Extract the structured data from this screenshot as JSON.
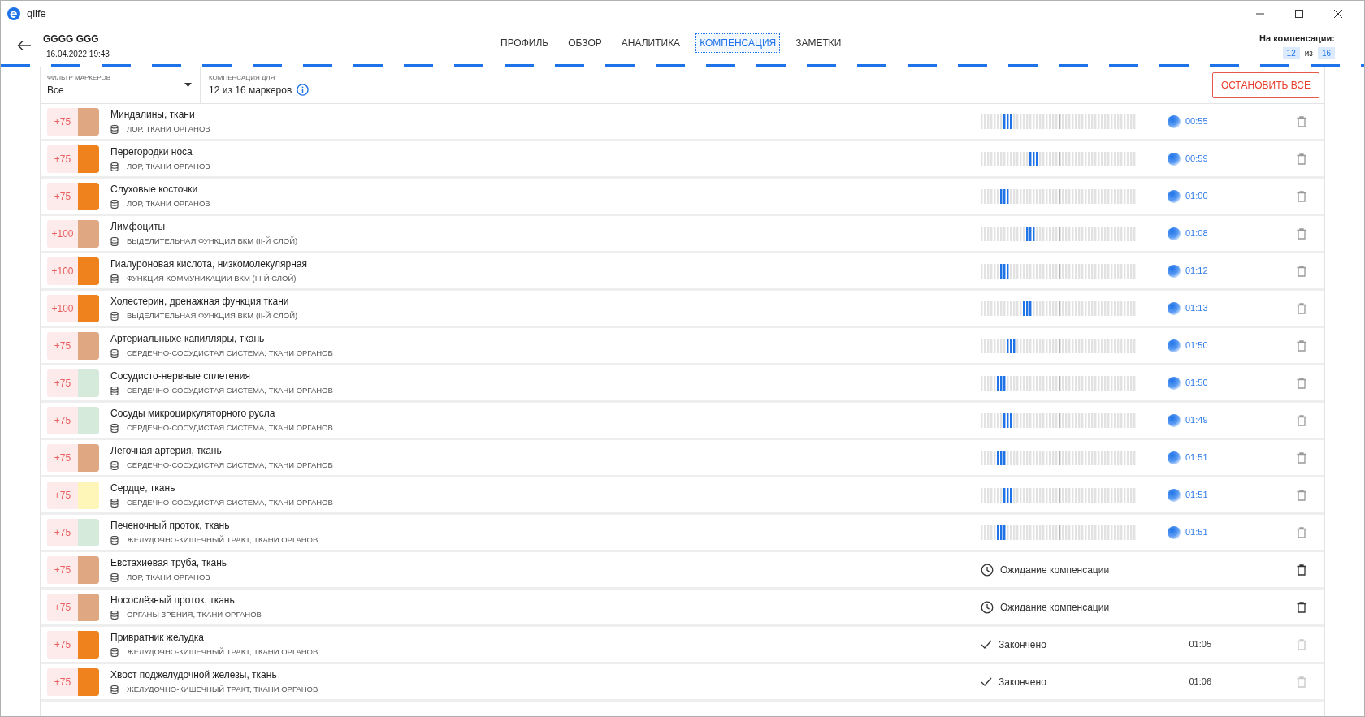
{
  "window": {
    "title": "qlife"
  },
  "header": {
    "patient": "GGGG GGG",
    "date": "16.04.2022 19:43"
  },
  "tabs": [
    {
      "label": "ПРОФИЛЬ",
      "selected": false
    },
    {
      "label": "ОБЗОР",
      "selected": false
    },
    {
      "label": "АНАЛИТИКА",
      "selected": false
    },
    {
      "label": "КОМПЕНСАЦИЯ",
      "selected": true
    },
    {
      "label": "ЗАМЕТКИ",
      "selected": false
    }
  ],
  "summary": {
    "label": "На компенсации:",
    "current": "12",
    "separator": "из",
    "total": "16"
  },
  "filter": {
    "label": "ФИЛЬТР МАРКЕРОВ",
    "value": "Все"
  },
  "compensation_for": {
    "label": "КОМПЕНСАЦИЯ ДЛЯ",
    "value": "12 из 16 маркеров"
  },
  "stop_all_button": "ОСТАНОВИТЬ ВСЕ",
  "rows": [
    {
      "kind": "active",
      "score": "+75",
      "color": "#dfa882",
      "name": "Миндалины, ткани",
      "category": "ЛОР, ТКАНИ ОРГАНОВ",
      "level": 0.16,
      "time": "00:55"
    },
    {
      "kind": "active",
      "score": "+75",
      "color": "#f0821e",
      "name": "Перегородки носа",
      "category": "ЛОР, ТКАНИ ОРГАНОВ",
      "level": 0.34,
      "time": "00:59"
    },
    {
      "kind": "active",
      "score": "+75",
      "color": "#f0821e",
      "name": "Слуховые косточки",
      "category": "ЛОР, ТКАНИ ОРГАНОВ",
      "level": 0.14,
      "time": "01:00"
    },
    {
      "kind": "active",
      "score": "+100",
      "color": "#dfa882",
      "name": "Лимфоциты",
      "category": "ВЫДЕЛИТЕЛЬНАЯ ФУНКЦИЯ ВКМ (II-Й СЛОЙ)",
      "level": 0.32,
      "time": "01:08"
    },
    {
      "kind": "active",
      "score": "+100",
      "color": "#f0821e",
      "name": "Гиалуроновая кислота, низкомолекулярная",
      "category": "ФУНКЦИЯ КОММУНИКАЦИИ ВКМ (III-Й СЛОЙ)",
      "level": 0.14,
      "time": "01:12"
    },
    {
      "kind": "active",
      "score": "+100",
      "color": "#f0821e",
      "name": "Холестерин, дренажная функция ткани",
      "category": "ВЫДЕЛИТЕЛЬНАЯ ФУНКЦИЯ ВКМ (II-Й СЛОЙ)",
      "level": 0.29,
      "time": "01:13"
    },
    {
      "kind": "active",
      "score": "+75",
      "color": "#dfa882",
      "name": "Артериальныхе капилляры, ткань",
      "category": "СЕРДЕЧНО-СОСУДИСТАЯ СИСТЕМА, ТКАНИ ОРГАНОВ",
      "level": 0.19,
      "time": "01:50"
    },
    {
      "kind": "active",
      "score": "+75",
      "color": "#d6eadb",
      "name": "Сосудисто-нервные сплетения",
      "category": "СЕРДЕЧНО-СОСУДИСТАЯ СИСТЕМА, ТКАНИ ОРГАНОВ",
      "level": 0.13,
      "time": "01:50"
    },
    {
      "kind": "active",
      "score": "+75",
      "color": "#d6eadb",
      "name": "Сосуды микроциркуляторного русла",
      "category": "СЕРДЕЧНО-СОСУДИСТАЯ СИСТЕМА, ТКАНИ ОРГАНОВ",
      "level": 0.16,
      "time": "01:49"
    },
    {
      "kind": "active",
      "score": "+75",
      "color": "#dfa882",
      "name": "Легочная артерия, ткань",
      "category": "СЕРДЕЧНО-СОСУДИСТАЯ СИСТЕМА, ТКАНИ ОРГАНОВ",
      "level": 0.13,
      "time": "01:51"
    },
    {
      "kind": "active",
      "score": "+75",
      "color": "#fdf6b8",
      "name": "Сердце, ткань",
      "category": "СЕРДЕЧНО-СОСУДИСТАЯ СИСТЕМА, ТКАНИ ОРГАНОВ",
      "level": 0.16,
      "time": "01:51"
    },
    {
      "kind": "active",
      "score": "+75",
      "color": "#d6eadb",
      "name": "Печеночный проток, ткань",
      "category": "ЖЕЛУДОЧНО-КИШЕЧНЫЙ ТРАКТ, ТКАНИ ОРГАНОВ",
      "level": 0.13,
      "time": "01:51"
    },
    {
      "kind": "waiting",
      "score": "+75",
      "color": "#dfa882",
      "name": "Евстахиевая труба, ткань",
      "category": "ЛОР, ТКАНИ ОРГАНОВ",
      "status": "Ожидание компенсации"
    },
    {
      "kind": "waiting",
      "score": "+75",
      "color": "#dfa882",
      "name": "Носослёзный проток, ткань",
      "category": "ОРГАНЫ ЗРЕНИЯ, ТКАНИ ОРГАНОВ",
      "status": "Ожидание компенсации"
    },
    {
      "kind": "done",
      "score": "+75",
      "color": "#f0821e",
      "name": "Привратник желудка",
      "category": "ЖЕЛУДОЧНО-КИШЕЧНЫЙ ТРАКТ, ТКАНИ ОРГАНОВ",
      "status": "Закончено",
      "time": "01:05"
    },
    {
      "kind": "done",
      "score": "+75",
      "color": "#f0821e",
      "name": "Хвост поджелудочной железы, ткань",
      "category": "ЖЕЛУДОЧНО-КИШЕЧНЫЙ ТРАКТ, ТКАНИ ОРГАНОВ",
      "status": "Закончено",
      "time": "01:06"
    }
  ]
}
